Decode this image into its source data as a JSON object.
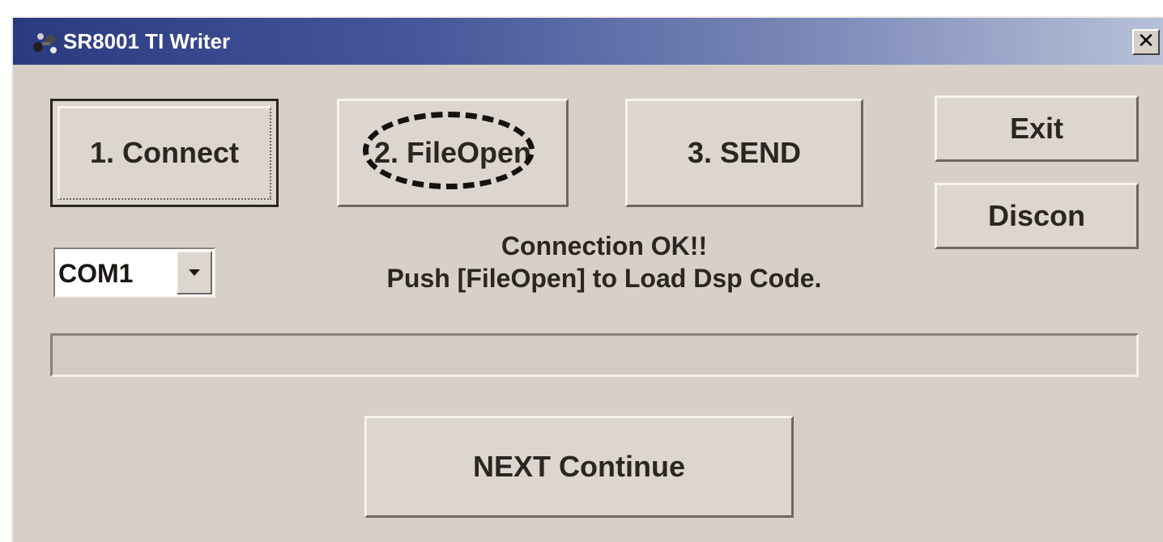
{
  "window": {
    "title": "SR8001 TI Writer",
    "icon": "app-icon",
    "close_label": "✕"
  },
  "buttons": {
    "connect": "1. Connect",
    "fileopen": "2. FileOpen",
    "send": "3. SEND",
    "exit": "Exit",
    "discon": "Discon",
    "next": "NEXT Continue"
  },
  "port_select": {
    "value": "COM1",
    "arrow_icon": "dropdown-arrow-icon"
  },
  "status": {
    "line1": "Connection OK!!",
    "line2": "Push [FileOpen] to Load Dsp Code."
  },
  "progress": {
    "fraction": 0
  },
  "colors": {
    "titlebar_start": "#2a3a7e",
    "face": "#d8d0c8",
    "highlight_marker": "#151310"
  }
}
